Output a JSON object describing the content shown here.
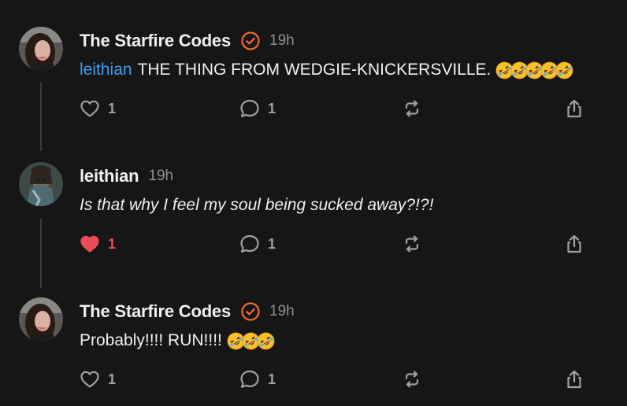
{
  "posts": [
    {
      "author": "The Starfire Codes",
      "verified": true,
      "time": "19h",
      "mention": "leithian",
      "text": "THE THING FROM WEDGIE-KNICKERSVILLE.",
      "emoji_count": 5,
      "italic": false,
      "likes": "1",
      "liked": false,
      "replies": "1"
    },
    {
      "author": "leithian",
      "verified": false,
      "time": "19h",
      "mention": "",
      "text": "Is that why I feel my soul being sucked away?!?!",
      "emoji_count": 0,
      "italic": true,
      "likes": "1",
      "liked": true,
      "replies": "1"
    },
    {
      "author": "The Starfire Codes",
      "verified": true,
      "time": "19h",
      "mention": "",
      "text": "Probably!!!! RUN!!!!",
      "emoji_count": 3,
      "italic": false,
      "likes": "1",
      "liked": false,
      "replies": "1"
    }
  ],
  "icons": {
    "like": "heart-icon",
    "reply": "speech-bubble-icon",
    "repost": "repost-icon",
    "share": "share-icon",
    "verified": "verified-check-badge-icon",
    "emoji": "rolling-on-floor-laughing-emoji"
  },
  "colors": {
    "background": "#161617",
    "mention": "#3d9ff0",
    "verified": "#f26b2a",
    "liked": "#ec4b55",
    "muted": "#8e8e93"
  }
}
